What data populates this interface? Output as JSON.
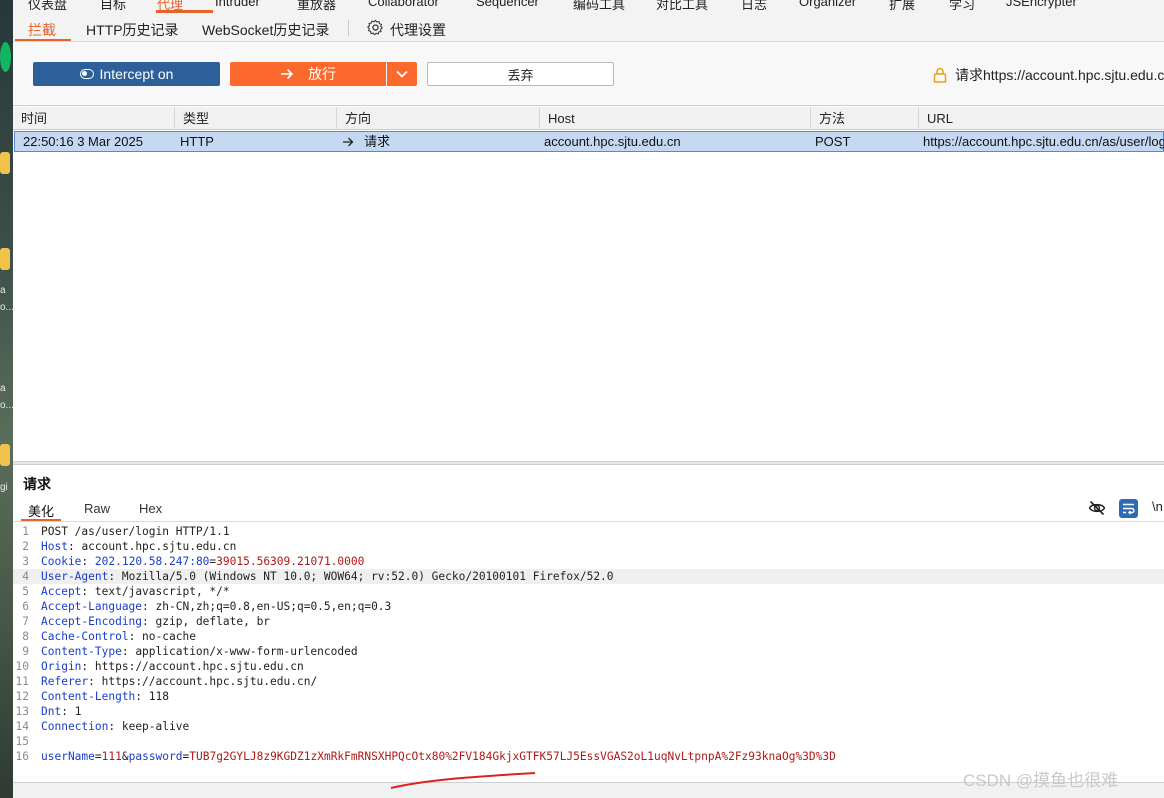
{
  "top_tabs": [
    "仪表盘",
    "目标",
    "代理",
    "Intruder",
    "重放器",
    "Collaborator",
    "Sequencer",
    "编码工具",
    "对比工具",
    "日志",
    "Organizer",
    "扩展",
    "学习",
    "JSEncrypter"
  ],
  "sub_tabs": {
    "intercept": "拦截",
    "http_history": "HTTP历史记录",
    "ws_history": "WebSocket历史记录",
    "proxy_settings": "代理设置"
  },
  "actions": {
    "intercept": "Intercept on",
    "forward": "放行",
    "drop": "丢弃",
    "request_info": "请求https://account.hpc.sjtu.edu.cn"
  },
  "table": {
    "columns": [
      "时间",
      "类型",
      "方向",
      "Host",
      "方法",
      "URL"
    ],
    "rows": [
      {
        "time": "22:50:16 3 Mar 2025",
        "type": "HTTP",
        "direction": "请求",
        "host": "account.hpc.sjtu.edu.cn",
        "method": "POST",
        "url": "https://account.hpc.sjtu.edu.cn/as/user/login"
      }
    ]
  },
  "request_panel": {
    "title": "请求",
    "view_tabs": {
      "pretty": "美化",
      "raw": "Raw",
      "hex": "Hex"
    },
    "nl_label": "\\n",
    "lines": [
      {
        "n": "1",
        "key": "",
        "sep": "",
        "val": "POST /as/user/login HTTP/1.1"
      },
      {
        "n": "2",
        "key": "Host",
        "sep": ": ",
        "val": "account.hpc.sjtu.edu.cn"
      },
      {
        "n": "3",
        "key": "Cookie",
        "sep": ": ",
        "val": "202.120.58.247:80=39015.56309.21071.0000"
      },
      {
        "n": "4",
        "key": "User-Agent",
        "sep": ": ",
        "val": "Mozilla/5.0 (Windows NT 10.0; WOW64; rv:52.0) Gecko/20100101 Firefox/52.0"
      },
      {
        "n": "5",
        "key": "Accept",
        "sep": ": ",
        "val": "text/javascript, */*"
      },
      {
        "n": "6",
        "key": "Accept-Language",
        "sep": ": ",
        "val": "zh-CN,zh;q=0.8,en-US;q=0.5,en;q=0.3"
      },
      {
        "n": "7",
        "key": "Accept-Encoding",
        "sep": ": ",
        "val": "gzip, deflate, br"
      },
      {
        "n": "8",
        "key": "Cache-Control",
        "sep": ": ",
        "val": "no-cache"
      },
      {
        "n": "9",
        "key": "Content-Type",
        "sep": ": ",
        "val": "application/x-www-form-urlencoded"
      },
      {
        "n": "10",
        "key": "Origin",
        "sep": ": ",
        "val": "https://account.hpc.sjtu.edu.cn"
      },
      {
        "n": "11",
        "key": "Referer",
        "sep": ": ",
        "val": "https://account.hpc.sjtu.edu.cn/"
      },
      {
        "n": "12",
        "key": "Content-Length",
        "sep": ": ",
        "val": "118"
      },
      {
        "n": "13",
        "key": "Dnt",
        "sep": ": ",
        "val": "1"
      },
      {
        "n": "14",
        "key": "Connection",
        "sep": ": ",
        "val": "keep-alive"
      },
      {
        "n": "15",
        "key": "",
        "sep": "",
        "val": ""
      },
      {
        "n": "16",
        "key": "",
        "sep": "",
        "val": ""
      }
    ],
    "body": {
      "k1": "userName",
      "v1": "111",
      "k2": "password",
      "v2": "TUB7g2GYLJ8z9KGDZ1zXmRkFmRNSXHPQcOtx80%2FV184GkjxGTFK57LJ5EssVGAS2oL1uqNvLtpnpA%2Fz93knaOg%3D%3D"
    }
  },
  "desktop_strip_text": [
    "a",
    "o...",
    "a",
    "o...",
    "gi"
  ],
  "watermark": "CSDN @摸鱼也很难"
}
